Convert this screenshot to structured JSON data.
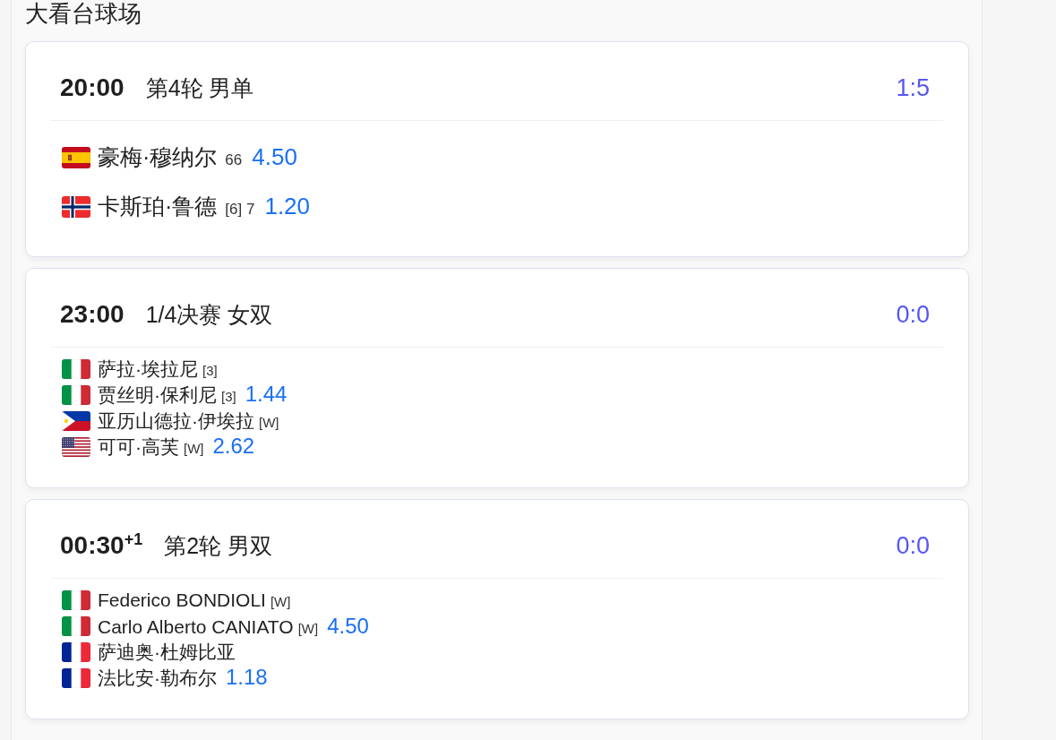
{
  "venue": {
    "title": "大看台球场"
  },
  "matches": [
    {
      "kind": "singles",
      "time": "20:00",
      "round": "第4轮 男单",
      "score": "1:5",
      "teams": [
        {
          "players": [
            {
              "name": "豪梅·穆纳尔",
              "flag": {
                "kind": "spain"
              },
              "note": "66"
            }
          ],
          "odds": "4.50"
        },
        {
          "players": [
            {
              "name": "卡斯珀·鲁德",
              "flag": {
                "kind": "norway"
              },
              "note": "[6] 7"
            }
          ],
          "odds": "1.20"
        }
      ]
    },
    {
      "kind": "doubles",
      "time": "23:00",
      "round": "1/4决赛 女双",
      "score": "0:0",
      "teams": [
        {
          "players": [
            {
              "name": "萨拉·埃拉尼",
              "flag": {
                "kind": "italy"
              },
              "note": "[3]"
            },
            {
              "name": "贾丝明·保利尼",
              "flag": {
                "kind": "italy"
              },
              "note": "[3]"
            }
          ],
          "odds": "1.44"
        },
        {
          "players": [
            {
              "name": "亚历山德拉·伊埃拉",
              "flag": {
                "kind": "philippines"
              },
              "note": "[W]"
            },
            {
              "name": "可可·高芙",
              "flag": {
                "kind": "usa"
              },
              "note": "[W]"
            }
          ],
          "odds": "2.62"
        }
      ]
    },
    {
      "kind": "doubles",
      "time": "00:30$^{+1}$",
      "round": "第2轮 男双",
      "score": "0:0",
      "teams": [
        {
          "players": [
            {
              "name": "Federico BONDIOLI",
              "flag": {
                "kind": "italy"
              },
              "note": "[W]"
            },
            {
              "name": "Carlo Alberto CANIATO",
              "flag": {
                "kind": "italy"
              },
              "note": "[W]"
            }
          ],
          "odds": "4.50"
        },
        {
          "players": [
            {
              "name": "萨迪奥·杜姆比亚",
              "flag": {
                "kind": "france"
              }
            },
            {
              "name": "法比安·勒布尔",
              "flag": {
                "kind": "france"
              }
            }
          ],
          "odds": "1.18"
        }
      ]
    }
  ]
}
